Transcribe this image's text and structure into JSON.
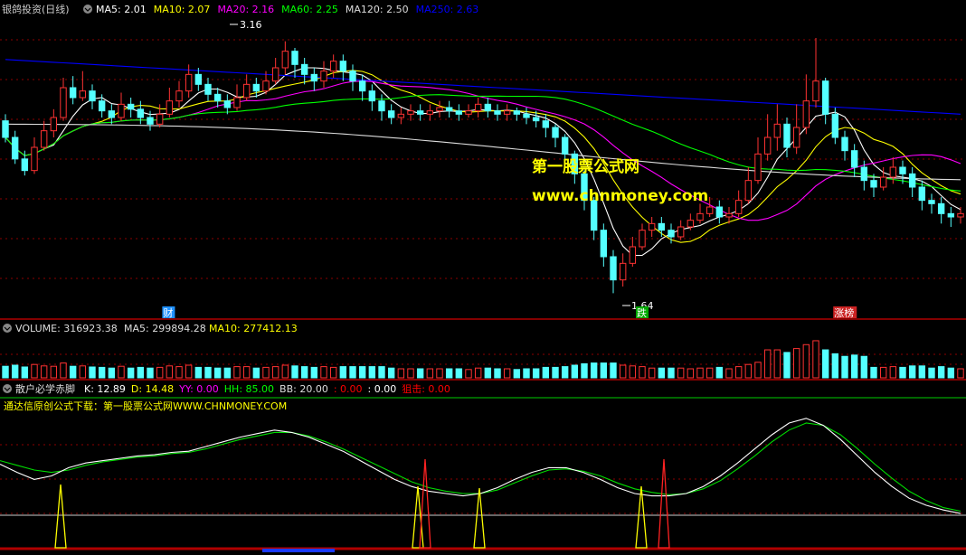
{
  "panel_main": {
    "title": "银鸽投资(日线)",
    "ma_items": [
      {
        "label": "MA5: 2.01",
        "color": "#ffffff"
      },
      {
        "label": "MA10: 2.07",
        "color": "#ffff00"
      },
      {
        "label": "MA20: 2.16",
        "color": "#ff00ff"
      },
      {
        "label": "MA60: 2.25",
        "color": "#00ff00"
      },
      {
        "label": "MA120: 2.50",
        "color": "#dddddd"
      },
      {
        "label": "MA250: 2.63",
        "color": "#0000ff"
      }
    ],
    "high_label": "3.16",
    "low_label": "1.64",
    "watermark_line1": "第一股票公式网",
    "watermark_line2": "www.chnmoney.com",
    "events": [
      {
        "label": "财",
        "color": "#1e90ff",
        "x_index": 37
      },
      {
        "label": "跌",
        "color": "#00aa00",
        "x_index": 145
      },
      {
        "label": "涨榜",
        "color": "#cc2222",
        "x_index": 190
      }
    ]
  },
  "panel_volume": {
    "title": "VOLUME: 316923.38",
    "ma5": "MA5: 299894.28",
    "ma10": "MA10: 277412.13"
  },
  "panel_indicator": {
    "title": "散户必学赤脚",
    "items": [
      {
        "label": "K: 12.89",
        "color": "#ffffff"
      },
      {
        "label": "D: 14.48",
        "color": "#ffff00"
      },
      {
        "label": "YY: 0.00",
        "color": "#ff00ff"
      },
      {
        "label": "HH: 85.00",
        "color": "#00ff00"
      },
      {
        "label": "BB: 20.00",
        "color": "#dddddd"
      },
      {
        "label": ": 0.00",
        "color": "#ff0000"
      },
      {
        "label": ": 0.00",
        "color": "#ffffff"
      },
      {
        "label": "狙击: 0.00",
        "color": "#ff0000"
      }
    ],
    "promo": "通达信原创公式下载：第一股票公式网WWW.CHNMONEY.COM"
  },
  "colors": {
    "up": "#ff3232",
    "down": "#54ffff",
    "grid": "#8b0000",
    "border": "#b00000"
  },
  "chart_data": {
    "type": "candlestick",
    "price_range": [
      1.5,
      3.3
    ],
    "candles": [
      [
        2.68,
        2.58,
        2.72,
        2.55
      ],
      [
        2.58,
        2.45,
        2.62,
        2.42
      ],
      [
        2.45,
        2.38,
        2.5,
        2.35
      ],
      [
        2.38,
        2.52,
        2.58,
        2.36
      ],
      [
        2.52,
        2.62,
        2.68,
        2.5
      ],
      [
        2.62,
        2.7,
        2.75,
        2.58
      ],
      [
        2.7,
        2.88,
        2.94,
        2.68
      ],
      [
        2.88,
        2.82,
        2.95,
        2.78
      ],
      [
        2.82,
        2.86,
        2.98,
        2.8
      ],
      [
        2.86,
        2.8,
        2.9,
        2.75
      ],
      [
        2.8,
        2.74,
        2.84,
        2.7
      ],
      [
        2.74,
        2.7,
        2.78,
        2.66
      ],
      [
        2.7,
        2.78,
        2.85,
        2.68
      ],
      [
        2.78,
        2.75,
        2.82,
        2.7
      ],
      [
        2.75,
        2.7,
        2.8,
        2.66
      ],
      [
        2.7,
        2.66,
        2.74,
        2.62
      ],
      [
        2.66,
        2.72,
        2.78,
        2.64
      ],
      [
        2.72,
        2.8,
        2.88,
        2.7
      ],
      [
        2.8,
        2.86,
        2.92,
        2.76
      ],
      [
        2.86,
        2.96,
        3.02,
        2.82
      ],
      [
        2.96,
        2.9,
        3.0,
        2.86
      ],
      [
        2.9,
        2.84,
        2.94,
        2.8
      ],
      [
        2.84,
        2.8,
        2.88,
        2.76
      ],
      [
        2.8,
        2.76,
        2.84,
        2.72
      ],
      [
        2.76,
        2.82,
        2.9,
        2.74
      ],
      [
        2.82,
        2.9,
        2.96,
        2.8
      ],
      [
        2.9,
        2.86,
        2.94,
        2.82
      ],
      [
        2.86,
        2.92,
        2.98,
        2.84
      ],
      [
        2.92,
        3.0,
        3.06,
        2.9
      ],
      [
        3.0,
        3.1,
        3.16,
        2.96
      ],
      [
        3.1,
        3.02,
        3.12,
        2.94
      ],
      [
        3.02,
        2.96,
        3.06,
        2.9
      ],
      [
        2.96,
        2.92,
        3.0,
        2.86
      ],
      [
        2.92,
        2.98,
        3.04,
        2.88
      ],
      [
        2.98,
        3.04,
        3.08,
        2.94
      ],
      [
        3.04,
        2.98,
        3.08,
        2.92
      ],
      [
        2.98,
        2.92,
        3.02,
        2.86
      ],
      [
        2.92,
        2.86,
        2.96,
        2.8
      ],
      [
        2.86,
        2.8,
        2.9,
        2.74
      ],
      [
        2.8,
        2.74,
        2.84,
        2.68
      ],
      [
        2.74,
        2.7,
        2.78,
        2.66
      ],
      [
        2.7,
        2.72,
        2.76,
        2.66
      ],
      [
        2.72,
        2.74,
        2.78,
        2.68
      ],
      [
        2.74,
        2.72,
        2.78,
        2.68
      ],
      [
        2.72,
        2.74,
        2.78,
        2.68
      ],
      [
        2.74,
        2.76,
        2.8,
        2.7
      ],
      [
        2.76,
        2.74,
        2.8,
        2.7
      ],
      [
        2.74,
        2.72,
        2.78,
        2.68
      ],
      [
        2.72,
        2.74,
        2.78,
        2.7
      ],
      [
        2.74,
        2.78,
        2.82,
        2.7
      ],
      [
        2.78,
        2.74,
        2.82,
        2.7
      ],
      [
        2.74,
        2.72,
        2.78,
        2.68
      ],
      [
        2.72,
        2.74,
        2.78,
        2.68
      ],
      [
        2.74,
        2.72,
        2.76,
        2.68
      ],
      [
        2.72,
        2.7,
        2.76,
        2.66
      ],
      [
        2.7,
        2.68,
        2.74,
        2.64
      ],
      [
        2.68,
        2.64,
        2.72,
        2.58
      ],
      [
        2.64,
        2.58,
        2.66,
        2.52
      ],
      [
        2.58,
        2.48,
        2.6,
        2.44
      ],
      [
        2.48,
        2.36,
        2.5,
        2.3
      ],
      [
        2.36,
        2.2,
        2.38,
        2.14
      ],
      [
        2.2,
        2.02,
        2.22,
        1.96
      ],
      [
        2.02,
        1.86,
        2.06,
        1.8
      ],
      [
        1.86,
        1.72,
        1.9,
        1.64
      ],
      [
        1.72,
        1.82,
        1.88,
        1.68
      ],
      [
        1.82,
        1.92,
        1.98,
        1.8
      ],
      [
        1.92,
        2.02,
        2.06,
        1.9
      ],
      [
        2.02,
        2.06,
        2.1,
        1.98
      ],
      [
        2.06,
        2.02,
        2.1,
        1.98
      ],
      [
        2.02,
        1.98,
        2.06,
        1.94
      ],
      [
        1.98,
        2.04,
        2.08,
        1.96
      ],
      [
        2.04,
        2.08,
        2.12,
        2.02
      ],
      [
        2.08,
        2.12,
        2.18,
        2.06
      ],
      [
        2.12,
        2.16,
        2.22,
        2.1
      ],
      [
        2.16,
        2.1,
        2.2,
        2.06
      ],
      [
        2.1,
        2.12,
        2.16,
        2.06
      ],
      [
        2.12,
        2.2,
        2.26,
        2.1
      ],
      [
        2.2,
        2.32,
        2.4,
        2.18
      ],
      [
        2.32,
        2.48,
        2.58,
        2.3
      ],
      [
        2.48,
        2.58,
        2.72,
        2.44
      ],
      [
        2.58,
        2.66,
        2.78,
        2.5
      ],
      [
        2.66,
        2.52,
        2.7,
        2.46
      ],
      [
        2.52,
        2.64,
        2.78,
        2.48
      ],
      [
        2.64,
        2.8,
        2.96,
        2.6
      ],
      [
        2.8,
        2.92,
        3.18,
        2.76
      ],
      [
        2.92,
        2.72,
        2.94,
        2.66
      ],
      [
        2.72,
        2.58,
        2.76,
        2.54
      ],
      [
        2.58,
        2.5,
        2.62,
        2.44
      ],
      [
        2.5,
        2.4,
        2.54,
        2.34
      ],
      [
        2.4,
        2.32,
        2.44,
        2.26
      ],
      [
        2.32,
        2.28,
        2.36,
        2.22
      ],
      [
        2.28,
        2.34,
        2.4,
        2.26
      ],
      [
        2.34,
        2.4,
        2.46,
        2.3
      ],
      [
        2.4,
        2.36,
        2.44,
        2.3
      ],
      [
        2.36,
        2.28,
        2.4,
        2.22
      ],
      [
        2.28,
        2.2,
        2.32,
        2.14
      ],
      [
        2.2,
        2.18,
        2.24,
        2.12
      ],
      [
        2.18,
        2.12,
        2.22,
        2.06
      ],
      [
        2.12,
        2.1,
        2.16,
        2.04
      ],
      [
        2.1,
        2.12,
        2.16,
        2.06
      ]
    ],
    "indicator_k": [
      55,
      48,
      42,
      45,
      52,
      56,
      58,
      60,
      62,
      63,
      65,
      66,
      70,
      74,
      78,
      81,
      84,
      82,
      78,
      72,
      66,
      58,
      50,
      42,
      36,
      32,
      30,
      28,
      30,
      35,
      42,
      48,
      52,
      52,
      48,
      42,
      35,
      30,
      28,
      28,
      30,
      36,
      45,
      56,
      68,
      80,
      90,
      94,
      88,
      76,
      62,
      48,
      36,
      26,
      20,
      16,
      13
    ],
    "indicator_d": [
      58,
      54,
      50,
      48,
      50,
      54,
      57,
      59,
      61,
      62,
      64,
      65,
      68,
      72,
      76,
      79,
      82,
      82,
      79,
      74,
      68,
      61,
      54,
      47,
      40,
      35,
      32,
      30,
      30,
      33,
      39,
      45,
      50,
      51,
      49,
      45,
      39,
      34,
      31,
      29,
      30,
      34,
      41,
      51,
      62,
      74,
      84,
      90,
      88,
      80,
      68,
      55,
      43,
      32,
      24,
      18,
      15
    ]
  }
}
